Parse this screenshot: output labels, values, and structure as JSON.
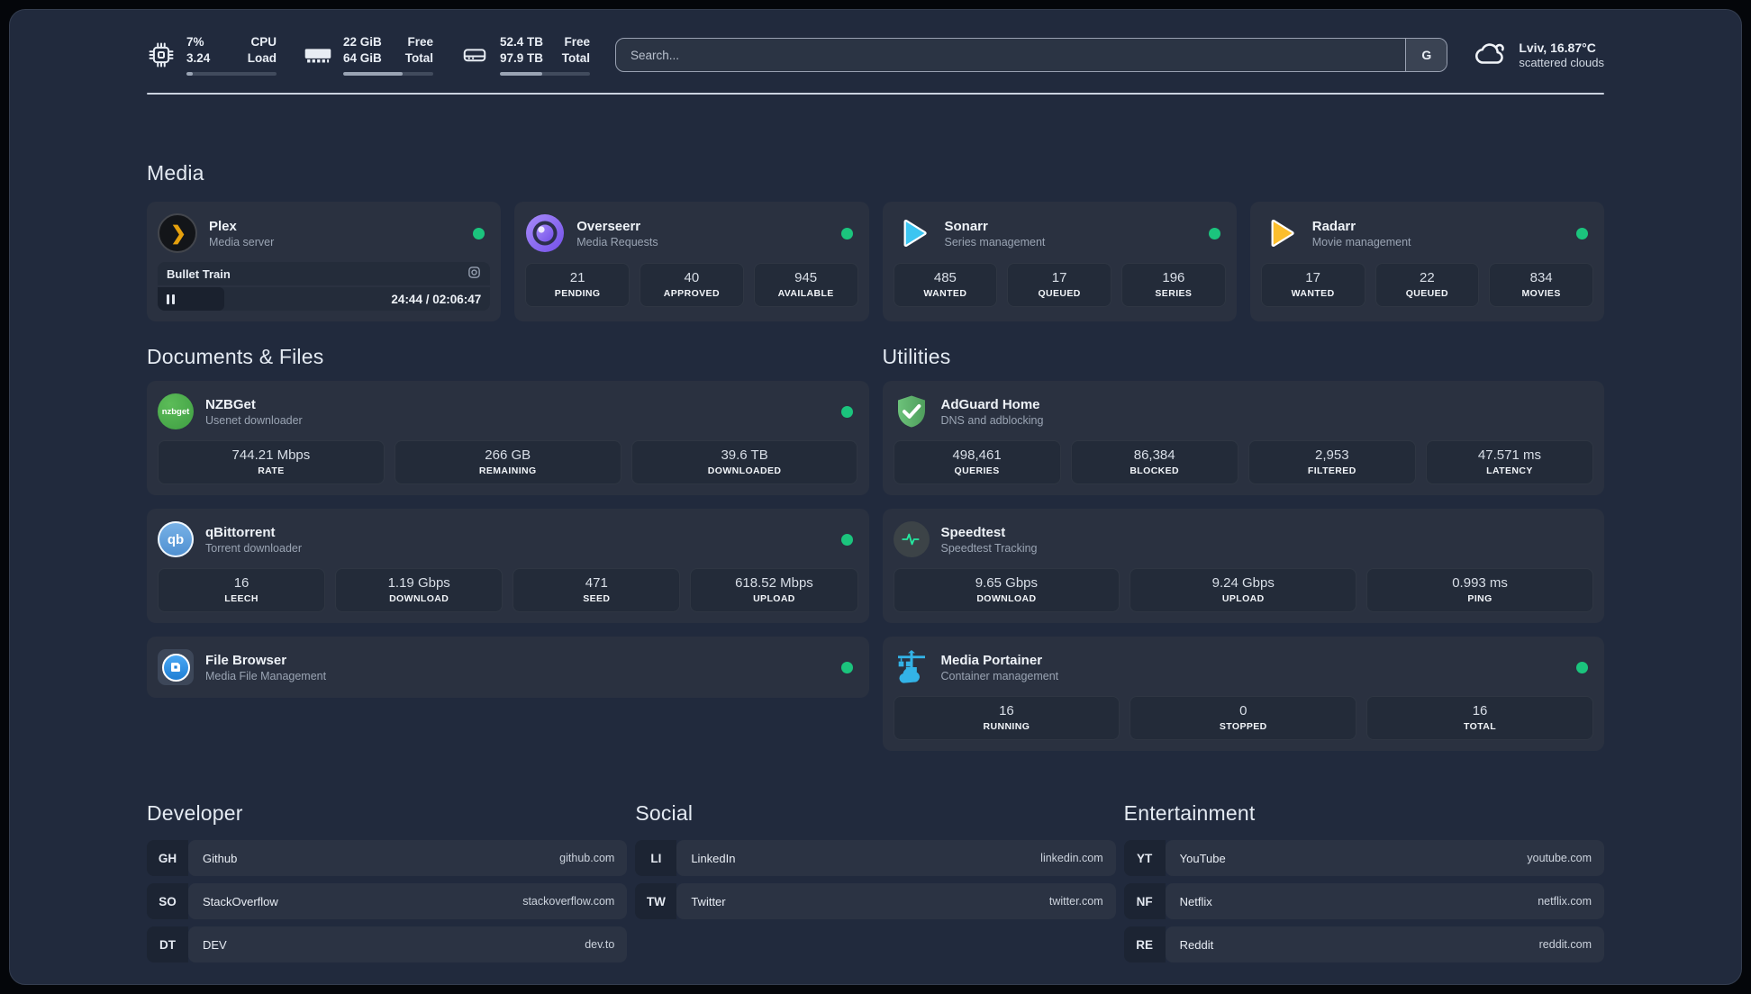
{
  "header": {
    "stats": [
      {
        "name": "cpu",
        "values": [
          "7%",
          "3.24"
        ],
        "labels": [
          "CPU",
          "Load"
        ],
        "progress": 7
      },
      {
        "name": "memory",
        "values": [
          "22 GiB",
          "64 GiB"
        ],
        "labels": [
          "Free",
          "Total"
        ],
        "progress": 66
      },
      {
        "name": "disk",
        "values": [
          "52.4 TB",
          "97.9 TB"
        ],
        "labels": [
          "Free",
          "Total"
        ],
        "progress": 47
      }
    ],
    "search": {
      "placeholder": "Search...",
      "button_label": "G"
    },
    "weather": {
      "location": "Lviv, 16.87°C",
      "condition": "scattered clouds"
    }
  },
  "sections": {
    "media": {
      "title": "Media",
      "cards": [
        {
          "name": "Plex",
          "description": "Media server",
          "online": true,
          "player": {
            "title": "Bullet Train",
            "time": "24:44 / 02:06:47",
            "progress": 20
          }
        },
        {
          "name": "Overseerr",
          "description": "Media Requests",
          "online": true,
          "stats": [
            {
              "value": "21",
              "label": "PENDING"
            },
            {
              "value": "40",
              "label": "APPROVED"
            },
            {
              "value": "945",
              "label": "AVAILABLE"
            }
          ]
        },
        {
          "name": "Sonarr",
          "description": "Series management",
          "online": true,
          "stats": [
            {
              "value": "485",
              "label": "WANTED"
            },
            {
              "value": "17",
              "label": "QUEUED"
            },
            {
              "value": "196",
              "label": "SERIES"
            }
          ]
        },
        {
          "name": "Radarr",
          "description": "Movie management",
          "online": true,
          "stats": [
            {
              "value": "17",
              "label": "WANTED"
            },
            {
              "value": "22",
              "label": "QUEUED"
            },
            {
              "value": "834",
              "label": "MOVIES"
            }
          ]
        }
      ]
    },
    "documents": {
      "title": "Documents & Files",
      "cards": [
        {
          "name": "NZBGet",
          "description": "Usenet downloader",
          "online": true,
          "stats": [
            {
              "value": "744.21 Mbps",
              "label": "RATE"
            },
            {
              "value": "266 GB",
              "label": "REMAINING"
            },
            {
              "value": "39.6 TB",
              "label": "DOWNLOADED"
            }
          ]
        },
        {
          "name": "qBittorrent",
          "description": "Torrent downloader",
          "online": true,
          "stats": [
            {
              "value": "16",
              "label": "LEECH"
            },
            {
              "value": "1.19 Gbps",
              "label": "DOWNLOAD"
            },
            {
              "value": "471",
              "label": "SEED"
            },
            {
              "value": "618.52 Mbps",
              "label": "UPLOAD"
            }
          ]
        },
        {
          "name": "File Browser",
          "description": "Media File Management",
          "online": true,
          "stats": []
        }
      ]
    },
    "utilities": {
      "title": "Utilities",
      "cards": [
        {
          "name": "AdGuard Home",
          "description": "DNS and adblocking",
          "online": false,
          "stats": [
            {
              "value": "498,461",
              "label": "QUERIES"
            },
            {
              "value": "86,384",
              "label": "BLOCKED"
            },
            {
              "value": "2,953",
              "label": "FILTERED"
            },
            {
              "value": "47.571 ms",
              "label": "LATENCY"
            }
          ]
        },
        {
          "name": "Speedtest",
          "description": "Speedtest Tracking",
          "online": false,
          "stats": [
            {
              "value": "9.65 Gbps",
              "label": "DOWNLOAD"
            },
            {
              "value": "9.24 Gbps",
              "label": "UPLOAD"
            },
            {
              "value": "0.993 ms",
              "label": "PING"
            }
          ]
        },
        {
          "name": "Media Portainer",
          "description": "Container management",
          "online": true,
          "stats": [
            {
              "value": "16",
              "label": "RUNNING"
            },
            {
              "value": "0",
              "label": "STOPPED"
            },
            {
              "value": "16",
              "label": "TOTAL"
            }
          ]
        }
      ]
    }
  },
  "link_groups": [
    {
      "title": "Developer",
      "items": [
        {
          "abbr": "GH",
          "name": "Github",
          "url": "github.com"
        },
        {
          "abbr": "SO",
          "name": "StackOverflow",
          "url": "stackoverflow.com"
        },
        {
          "abbr": "DT",
          "name": "DEV",
          "url": "dev.to"
        }
      ]
    },
    {
      "title": "Social",
      "items": [
        {
          "abbr": "LI",
          "name": "LinkedIn",
          "url": "linkedin.com"
        },
        {
          "abbr": "TW",
          "name": "Twitter",
          "url": "twitter.com"
        }
      ]
    },
    {
      "title": "Entertainment",
      "items": [
        {
          "abbr": "YT",
          "name": "YouTube",
          "url": "youtube.com"
        },
        {
          "abbr": "NF",
          "name": "Netflix",
          "url": "netflix.com"
        },
        {
          "abbr": "RE",
          "name": "Reddit",
          "url": "reddit.com"
        }
      ]
    }
  ],
  "icons": {
    "plex_glyph": "❯",
    "nzbget_label": "nzbget",
    "qbittorrent_label": "qb"
  },
  "colors": {
    "background": "#212a3d",
    "card": "#2a3140",
    "tile": "#232b39",
    "accent_green": "#1bc47d",
    "text_primary": "#e9eef5",
    "text_secondary": "#9aa4b3"
  }
}
